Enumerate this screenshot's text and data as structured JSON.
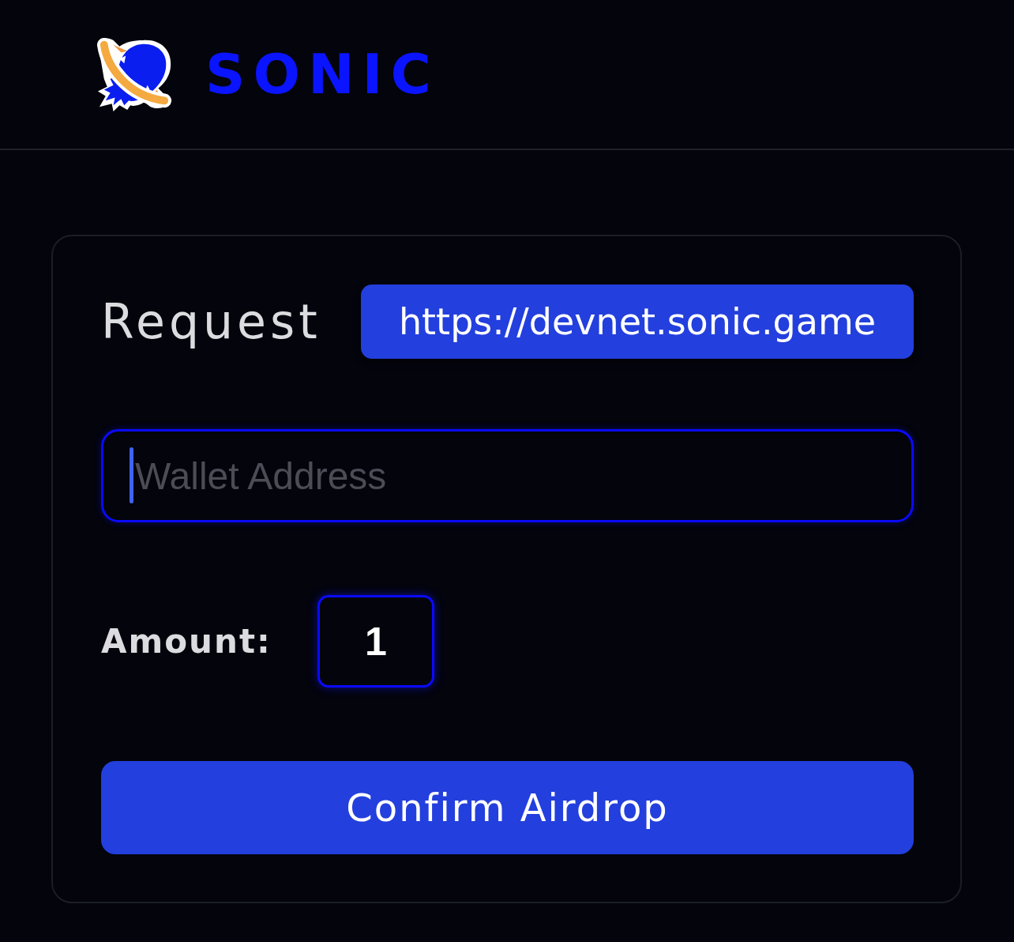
{
  "header": {
    "logo_text": "SONIC"
  },
  "card": {
    "title": "Request",
    "tooltip": "https://devnet.sonic.game",
    "wallet_field": {
      "placeholder": "Wallet Address",
      "focused": true
    },
    "amount": {
      "label": "Amount:",
      "value": "1"
    },
    "confirm_button": "Confirm Airdrop"
  }
}
